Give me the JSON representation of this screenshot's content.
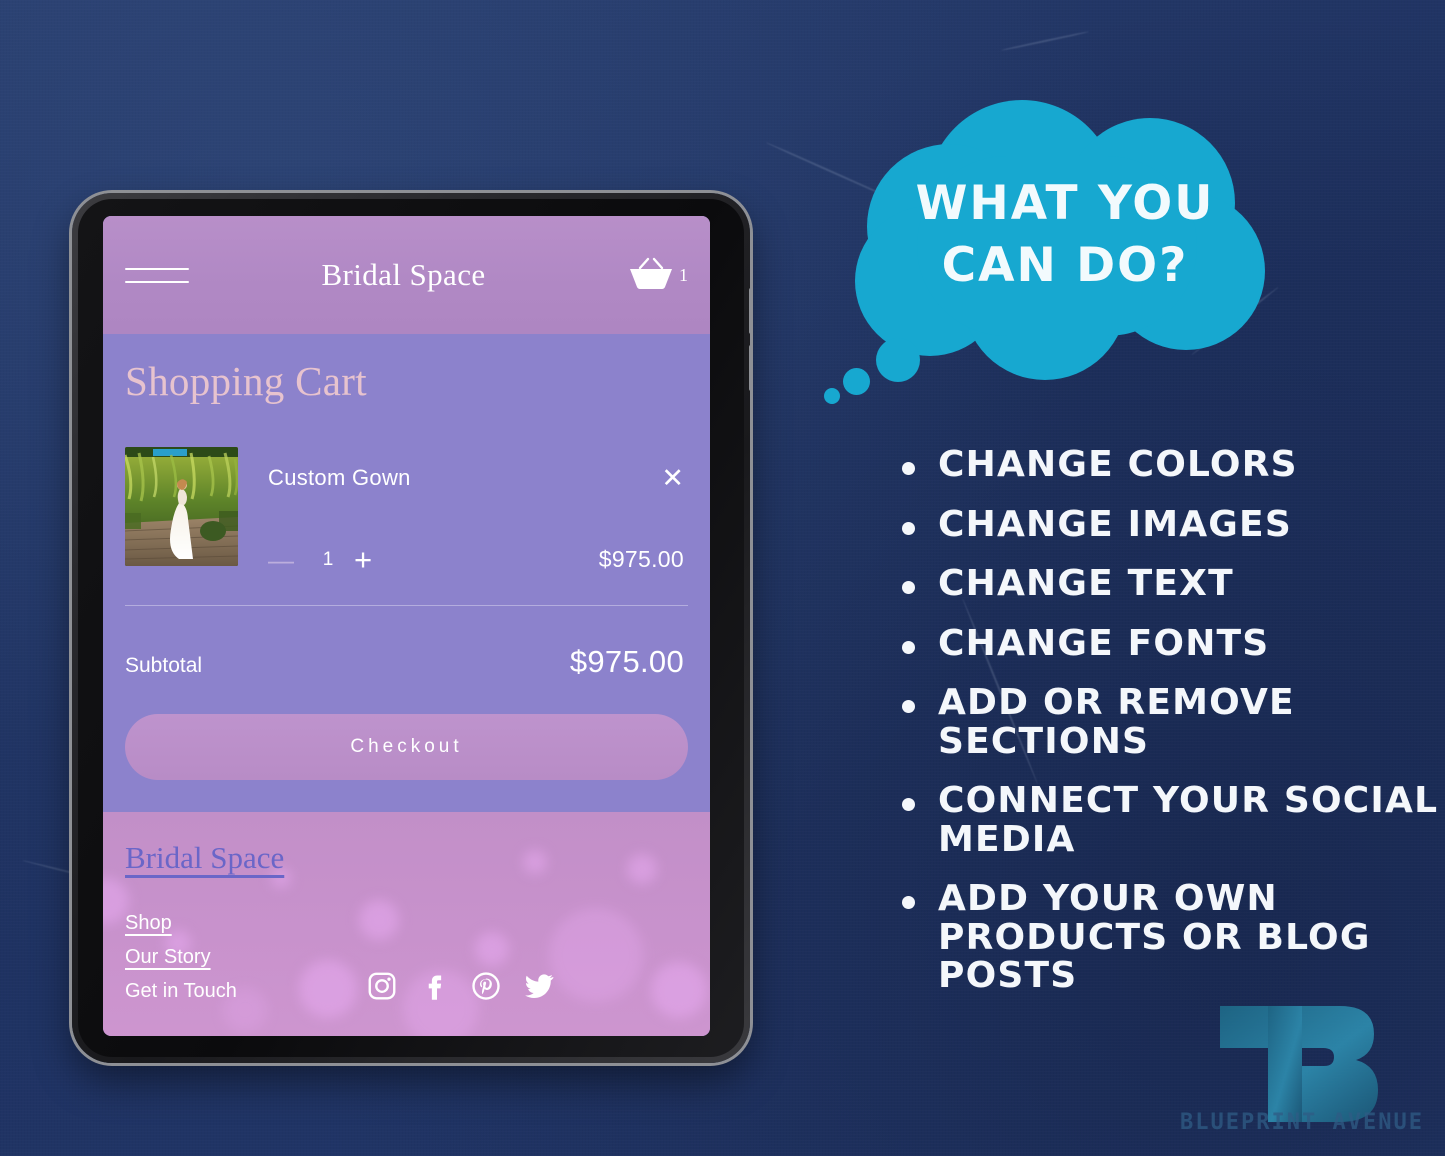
{
  "background": {
    "color": "#223563",
    "style": "navy textured paper"
  },
  "promo": {
    "bubble_title_line1": "WHAT YOU",
    "bubble_title_line2": "CAN DO?",
    "bubble_color": "#17A8D0",
    "bullets": [
      "CHANGE COLORS",
      "CHANGE IMAGES",
      "CHANGE TEXT",
      "CHANGE FONTS",
      "ADD OR REMOVE SECTIONS",
      "CONNECT YOUR SOCIAL MEDIA",
      "ADD YOUR OWN PRODUCTS OR BLOG POSTS"
    ]
  },
  "watermark": {
    "label": "BLUEPRINT AVENUE",
    "logo_letter": "B",
    "color": "#2F86A8"
  },
  "device": {
    "type": "tablet",
    "frame_color": "#19191c",
    "edge_color": "#8e9095"
  },
  "site": {
    "header": {
      "menu_icon": "hamburger-icon",
      "brand": "Bridal Space",
      "cart_icon": "basket-icon",
      "cart_count": "1",
      "background": "#B088C4"
    },
    "cart": {
      "title": "Shopping Cart",
      "title_color": "#E7C3CE",
      "background": "#8C82CC",
      "items": [
        {
          "name": "Custom Gown",
          "quantity": "1",
          "price": "$975.00",
          "decrease_label": "—",
          "increase_label": "+",
          "remove_label": "✕",
          "thumbnail_alt": "bride in white gown on wooden bridge"
        }
      ],
      "subtotal_label": "Subtotal",
      "subtotal_value": "$975.00",
      "checkout_label": "Checkout",
      "checkout_color": "#B88CC6"
    },
    "footer": {
      "logo": "Bridal Space",
      "logo_color": "#6A66C8",
      "background": "#C892CC",
      "links": [
        {
          "label": "Shop",
          "underlined": true
        },
        {
          "label": "Our Story",
          "underlined": true
        },
        {
          "label": "Get in Touch",
          "underlined": false
        }
      ],
      "socials": [
        {
          "name": "instagram-icon"
        },
        {
          "name": "facebook-icon"
        },
        {
          "name": "pinterest-icon"
        },
        {
          "name": "twitter-icon"
        }
      ]
    }
  }
}
